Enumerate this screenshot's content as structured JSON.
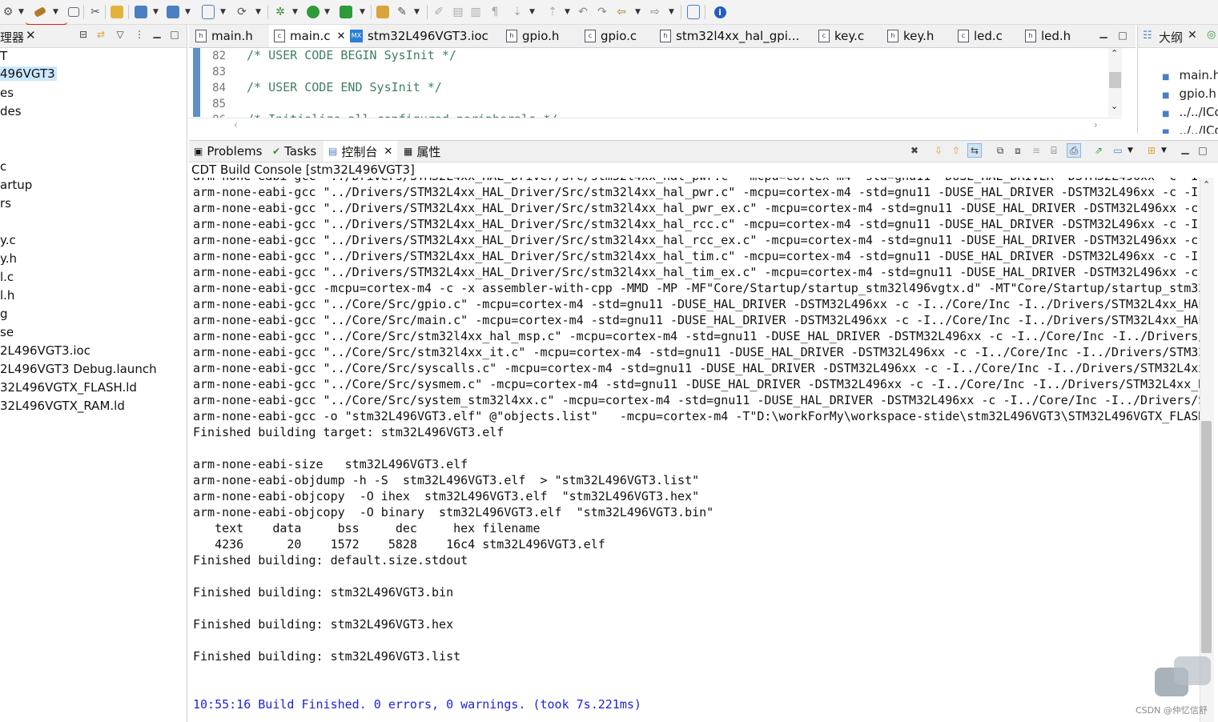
{
  "toolbar": {
    "icons": [
      "settings-icon",
      "build-hammer-icon",
      "build-dropdown-icon",
      "debug-icon",
      "clean-icon",
      "flash-icon",
      "new-folder-icon",
      "new-file-icon",
      "new-class-icon",
      "refresh-icon",
      "bug-icon",
      "run-icon",
      "external-tool-icon",
      "open-icon",
      "search-icon",
      "edit-icon",
      "toggle-mark-icon",
      "format-icon",
      "pilcrow-icon",
      "next-annotation-icon",
      "prev-annotation-icon",
      "back-icon",
      "forward-icon",
      "nav-back-icon",
      "nav-forward-icon",
      "perspective-icon",
      "info-icon"
    ]
  },
  "left_panel": {
    "title": "理器",
    "tree": [
      {
        "label": "T"
      },
      {
        "label": "496VGT3",
        "selected": true
      },
      {
        "label": "es"
      },
      {
        "label": "des"
      },
      {
        "label": "c"
      },
      {
        "label": "artup"
      },
      {
        "label": "rs"
      },
      {
        "label": "y.c"
      },
      {
        "label": "y.h"
      },
      {
        "label": "l.c"
      },
      {
        "label": "l.h"
      },
      {
        "label": "g"
      },
      {
        "label": "se"
      },
      {
        "label": "2L496VGT3.ioc"
      },
      {
        "label": "2L496VGT3 Debug.launch"
      },
      {
        "label": "32L496VGTX_FLASH.ld"
      },
      {
        "label": "32L496VGTX_RAM.ld"
      }
    ]
  },
  "editor": {
    "tabs": [
      {
        "label": "main.h",
        "icon": "h"
      },
      {
        "label": "main.c",
        "icon": "c",
        "active": true,
        "closable": true
      },
      {
        "label": "stm32L496VGT3.ioc",
        "icon": "MX"
      },
      {
        "label": "gpio.h",
        "icon": "h"
      },
      {
        "label": "gpio.c",
        "icon": "c"
      },
      {
        "label": "stm32l4xx_hal_gpi...",
        "icon": "h"
      },
      {
        "label": "key.c",
        "icon": "c"
      },
      {
        "label": "key.h",
        "icon": "h"
      },
      {
        "label": "led.c",
        "icon": "c"
      },
      {
        "label": "led.h",
        "icon": "h"
      }
    ],
    "lines": [
      {
        "num": "82",
        "text": "/* USER CODE BEGIN SysInit */"
      },
      {
        "num": "83",
        "text": ""
      },
      {
        "num": "84",
        "text": "/* USER CODE END SysInit */"
      },
      {
        "num": "85",
        "text": ""
      },
      {
        "num": "86",
        "text": "/* Initialize all configured peripherals */"
      }
    ]
  },
  "outline": {
    "title": "大纲",
    "items": [
      "main.h",
      "gpio.h",
      "../../ICo",
      "../../ICo"
    ]
  },
  "bottom": {
    "tabs": [
      {
        "label": "Problems"
      },
      {
        "label": "Tasks"
      },
      {
        "label": "控制台",
        "active": true,
        "closable": true
      },
      {
        "label": "属性"
      }
    ],
    "console_title": "CDT Build Console [stm32L496VGT3]",
    "lines": [
      "arm-none-eabi-gcc \"../Drivers/STM32L4xx_HAL_Driver/Src/stm32l4xx_hal_pwr.c\" -mcpu=cortex-m4 -std=gnu11 -DUSE_HAL_DRIVER -DSTM32L496xx -c -I.",
      "arm-none-eabi-gcc \"../Drivers/STM32L4xx_HAL_Driver/Src/stm32l4xx_hal_pwr.c\" -mcpu=cortex-m4 -std=gnu11 -DUSE_HAL_DRIVER -DSTM32L496xx -c -I.",
      "arm-none-eabi-gcc \"../Drivers/STM32L4xx_HAL_Driver/Src/stm32l4xx_hal_pwr_ex.c\" -mcpu=cortex-m4 -std=gnu11 -DUSE_HAL_DRIVER -DSTM32L496xx -c",
      "arm-none-eabi-gcc \"../Drivers/STM32L4xx_HAL_Driver/Src/stm32l4xx_hal_rcc.c\" -mcpu=cortex-m4 -std=gnu11 -DUSE_HAL_DRIVER -DSTM32L496xx -c -I.",
      "arm-none-eabi-gcc \"../Drivers/STM32L4xx_HAL_Driver/Src/stm32l4xx_hal_rcc_ex.c\" -mcpu=cortex-m4 -std=gnu11 -DUSE_HAL_DRIVER -DSTM32L496xx -c",
      "arm-none-eabi-gcc \"../Drivers/STM32L4xx_HAL_Driver/Src/stm32l4xx_hal_tim.c\" -mcpu=cortex-m4 -std=gnu11 -DUSE_HAL_DRIVER -DSTM32L496xx -c -I.",
      "arm-none-eabi-gcc \"../Drivers/STM32L4xx_HAL_Driver/Src/stm32l4xx_hal_tim_ex.c\" -mcpu=cortex-m4 -std=gnu11 -DUSE_HAL_DRIVER -DSTM32L496xx -c",
      "arm-none-eabi-gcc -mcpu=cortex-m4 -c -x assembler-with-cpp -MMD -MP -MF\"Core/Startup/startup_stm32l496vgtx.d\" -MT\"Core/Startup/startup_stm32",
      "arm-none-eabi-gcc \"../Core/Src/gpio.c\" -mcpu=cortex-m4 -std=gnu11 -DUSE_HAL_DRIVER -DSTM32L496xx -c -I../Core/Inc -I../Drivers/STM32L4xx_HAL",
      "arm-none-eabi-gcc \"../Core/Src/main.c\" -mcpu=cortex-m4 -std=gnu11 -DUSE_HAL_DRIVER -DSTM32L496xx -c -I../Core/Inc -I../Drivers/STM32L4xx_HAL",
      "arm-none-eabi-gcc \"../Core/Src/stm32l4xx_hal_msp.c\" -mcpu=cortex-m4 -std=gnu11 -DUSE_HAL_DRIVER -DSTM32L496xx -c -I../Core/Inc -I../Drivers/",
      "arm-none-eabi-gcc \"../Core/Src/stm32l4xx_it.c\" -mcpu=cortex-m4 -std=gnu11 -DUSE_HAL_DRIVER -DSTM32L496xx -c -I../Core/Inc -I../Drivers/STM32",
      "arm-none-eabi-gcc \"../Core/Src/syscalls.c\" -mcpu=cortex-m4 -std=gnu11 -DUSE_HAL_DRIVER -DSTM32L496xx -c -I../Core/Inc -I../Drivers/STM32L4xx",
      "arm-none-eabi-gcc \"../Core/Src/sysmem.c\" -mcpu=cortex-m4 -std=gnu11 -DUSE_HAL_DRIVER -DSTM32L496xx -c -I../Core/Inc -I../Drivers/STM32L4xx_H",
      "arm-none-eabi-gcc \"../Core/Src/system_stm32l4xx.c\" -mcpu=cortex-m4 -std=gnu11 -DUSE_HAL_DRIVER -DSTM32L496xx -c -I../Core/Inc -I../Drivers/S",
      "arm-none-eabi-gcc -o \"stm32L496VGT3.elf\" @\"objects.list\"   -mcpu=cortex-m4 -T\"D:\\workForMy\\workspace-stide\\stm32L496VGT3\\STM32L496VGTX_FLASH",
      "Finished building target: stm32L496VGT3.elf",
      "",
      "arm-none-eabi-size   stm32L496VGT3.elf",
      "arm-none-eabi-objdump -h -S  stm32L496VGT3.elf  > \"stm32L496VGT3.list\"",
      "arm-none-eabi-objcopy  -O ihex  stm32L496VGT3.elf  \"stm32L496VGT3.hex\"",
      "arm-none-eabi-objcopy  -O binary  stm32L496VGT3.elf  \"stm32L496VGT3.bin\"",
      "   text    data     bss     dec     hex filename",
      "   4236      20    1572    5828    16c4 stm32L496VGT3.elf",
      "Finished building: default.size.stdout",
      "",
      "Finished building: stm32L496VGT3.bin",
      "",
      "Finished building: stm32L496VGT3.hex",
      "",
      "Finished building: stm32L496VGT3.list",
      "",
      "",
      "10:55:16 Build Finished. 0 errors, 0 warnings. (took 7s.221ms)"
    ],
    "watermark": "CSDN @仲忆信舒"
  },
  "colors": {
    "accent_blue": "#1d24d4",
    "comment_green": "#3f7f5f",
    "selection": "#cce8ff",
    "annotation_red": "#e02020"
  }
}
